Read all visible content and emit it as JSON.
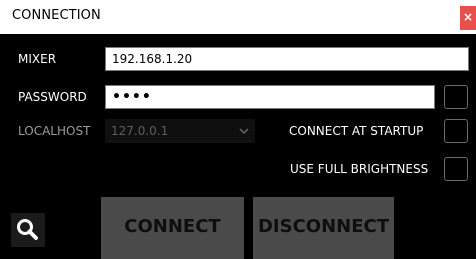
{
  "window": {
    "title": "CONNECTION",
    "close_label": "×"
  },
  "form": {
    "mixer_label": "MIXER",
    "mixer_value": "192.168.1.20",
    "password_label": "PASSWORD",
    "password_value": "••••",
    "localhost_label": "LOCALHOST",
    "localhost_value": "127.0.0.1",
    "connect_at_startup_label": "CONNECT AT STARTUP",
    "use_full_brightness_label": "USE FULL BRIGHTNESS"
  },
  "checkboxes": {
    "show_password_checked": false,
    "connect_at_startup_checked": false,
    "use_full_brightness_checked": false
  },
  "buttons": {
    "connect_label": "CONNECT",
    "disconnect_label": "DISCONNECT"
  },
  "icons": {
    "close": "close-icon",
    "dropdown": "chevron-down-icon",
    "search": "search-icon"
  },
  "colors": {
    "titlebar_bg": "#ffffff",
    "window_bg": "#000000",
    "close_bg": "#e8504e",
    "button_bg": "#4a4a4a",
    "button_text": "#0e0e0e",
    "checkbox_border": "#6a6a6a"
  }
}
